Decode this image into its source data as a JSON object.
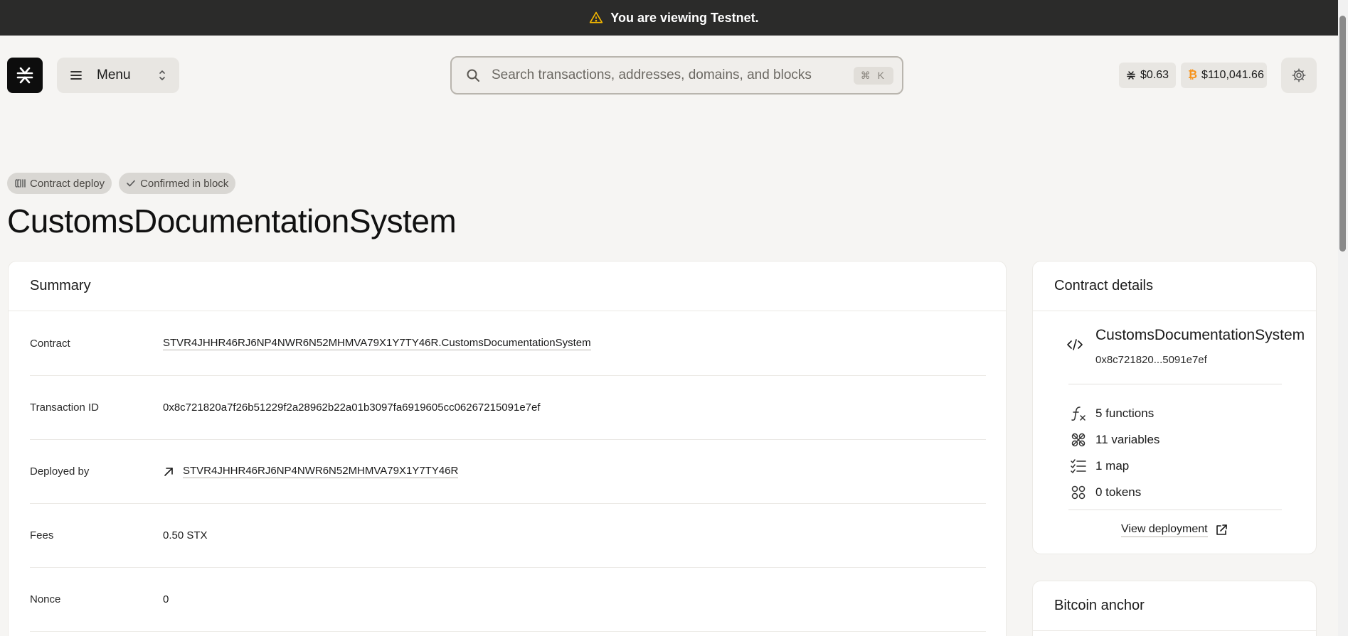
{
  "banner": {
    "text": "You are viewing Testnet.",
    "icon": "warning-icon",
    "icon_color": "#f5b800"
  },
  "nav": {
    "logo_icon": "stacks-logo-icon",
    "menu_label": "Menu",
    "search_placeholder": "Search transactions, addresses, domains, and blocks",
    "search_shortcut": "⌘ K",
    "stx_price": "$0.63",
    "btc_price": "$110,041.66",
    "btc_color": "#f7931a"
  },
  "header": {
    "badges": [
      {
        "label": "Contract deploy",
        "icon": "contract-icon"
      },
      {
        "label": "Confirmed in block",
        "icon": "check-icon"
      }
    ],
    "title": "CustomsDocumentationSystem"
  },
  "summary": {
    "title": "Summary",
    "rows": [
      {
        "label": "Contract",
        "value": "STVR4JHHR46RJ6NP4NWR6N52MHMVA79X1Y7TY46R.CustomsDocumentationSystem"
      },
      {
        "label": "Transaction ID",
        "value": "0x8c721820a7f26b51229f2a28962b22a01b3097fa6919605cc06267215091e7ef"
      },
      {
        "label": "Deployed by",
        "value": "STVR4JHHR46RJ6NP4NWR6N52MHMVA79X1Y7TY46R"
      },
      {
        "label": "Fees",
        "value": "0.50 STX"
      },
      {
        "label": "Nonce",
        "value": "0"
      }
    ]
  },
  "contract_details": {
    "title": "Contract details",
    "name": "CustomsDocumentationSystem",
    "hash": "0x8c721820...5091e7ef",
    "stats": [
      {
        "label": "5 functions",
        "icon": "function-icon"
      },
      {
        "label": "11 variables",
        "icon": "variable-icon"
      },
      {
        "label": "1 map",
        "icon": "list-check-icon"
      },
      {
        "label": "0 tokens",
        "icon": "tokens-icon"
      }
    ],
    "view_deployment": "View deployment"
  },
  "bitcoin_anchor": {
    "title": "Bitcoin anchor"
  }
}
